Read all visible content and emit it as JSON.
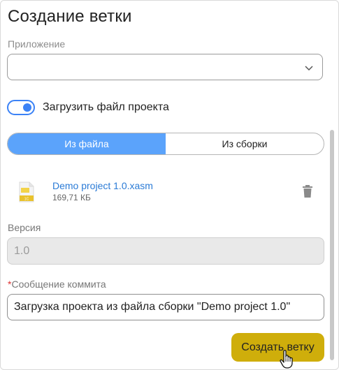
{
  "dialog": {
    "title": "Создание ветки"
  },
  "app_field": {
    "label": "Приложение",
    "value": ""
  },
  "toggle": {
    "label": "Загрузить файл проекта",
    "on": true
  },
  "segmented": {
    "options": [
      "Из файла",
      "Из сборки"
    ],
    "selected": "Из файла"
  },
  "file": {
    "name": "Demo project 1.0.xasm",
    "size": "169,71 КБ"
  },
  "version_field": {
    "label": "Версия",
    "value": "1.0"
  },
  "commit_field": {
    "required_mark": "*",
    "label": "Сообщение коммита",
    "value": "Загрузка проекта из файла сборки \"Demo project 1.0\""
  },
  "actions": {
    "create_label": "Создать ветку"
  },
  "colors": {
    "accent": "#3b82f6",
    "segment_active": "#5ba3fb",
    "primary_button": "#cfae0b",
    "link": "#2b7bd6",
    "required": "#dd3333"
  },
  "icons": [
    "chevron-down-icon",
    "file-icon",
    "trash-icon",
    "hand-pointer-icon"
  ]
}
